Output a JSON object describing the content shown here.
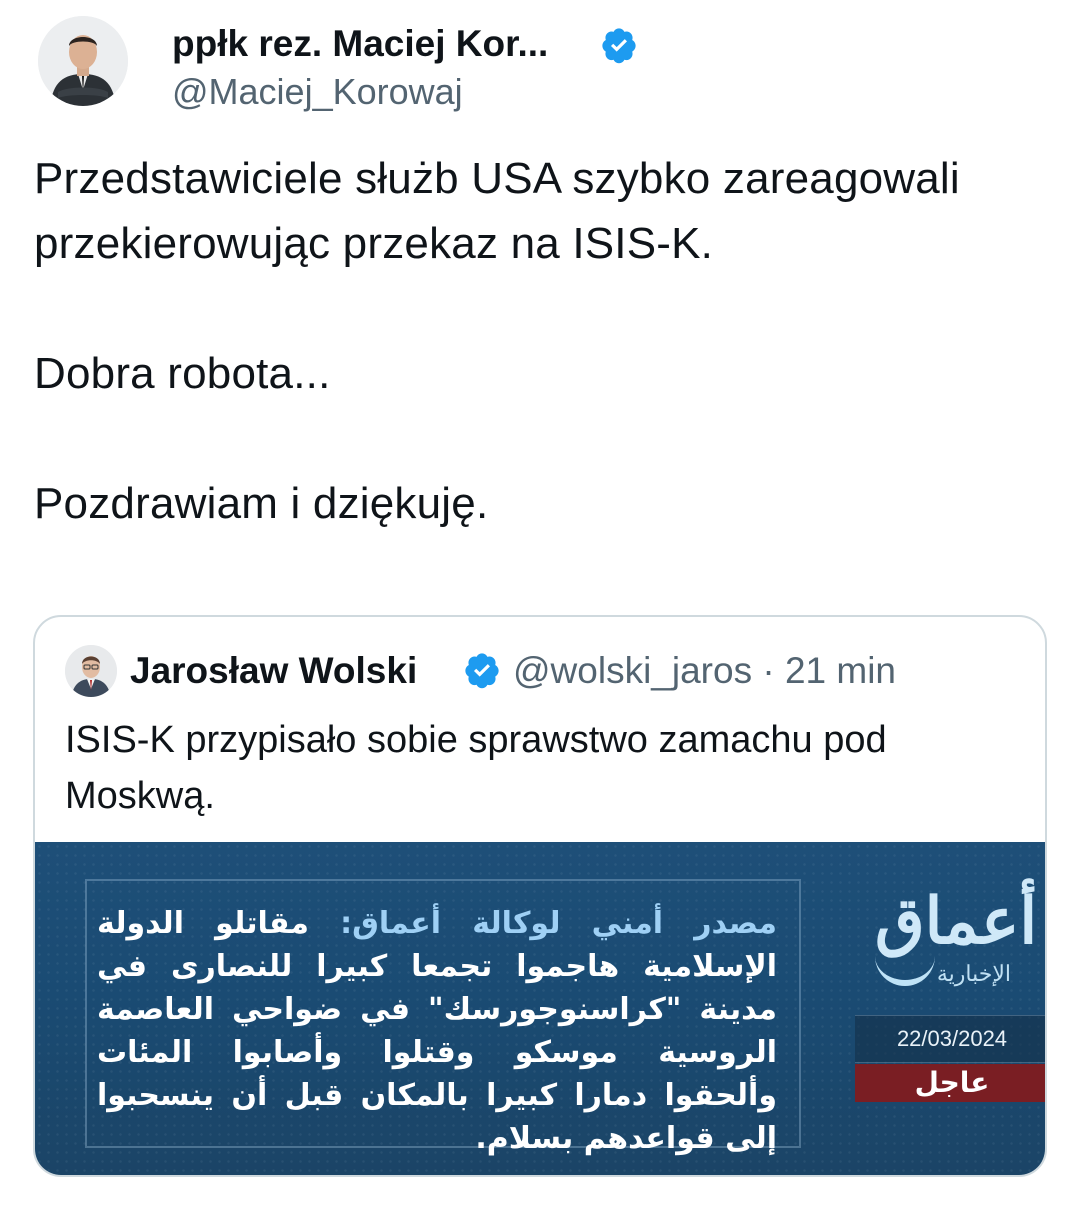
{
  "author": {
    "display_name": "ppłk rez. Maciej Kor...",
    "handle": "@Maciej_Korowaj",
    "verified": true
  },
  "tweet": {
    "paragraphs": [
      "Przedstawiciele służb USA szybko zareagowali przekierowując przekaz na ISIS-K.",
      "Dobra robota...",
      "Pozdrawiam i dziękuję."
    ]
  },
  "quote": {
    "display_name": "Jarosław Wolski",
    "handle_time": "@wolski_jaros · 21 min",
    "text": "ISIS-K przypisało sobie sprawstwo zamachu pod Moskwą.",
    "media": {
      "arabic_lead": "مصدر أمني لوكالة أعماق:",
      "arabic_body": "مقاتلو الدولة الإسلامية هاجموا تجمعا كبيرا للنصارى في مدينة \"كراسنوجورسك\" في ضواحي العاصمة الروسية موسكو وقتلوا وأصابوا المئات وألحقوا دمارا كبيرا بالمكان قبل أن ينسحبوا إلى قواعدهم بسلام.",
      "logo_main": "أعماق",
      "logo_sub": "الإخبارية",
      "date": "22/03/2024",
      "urgent_label": "عاجل"
    }
  },
  "colors": {
    "text": "#0f1419",
    "secondary": "#536471",
    "verified": "#1d9bf0",
    "border": "#cfd9de",
    "media_bg": "#1b4b73",
    "urgent_bg": "#7a1e23"
  }
}
